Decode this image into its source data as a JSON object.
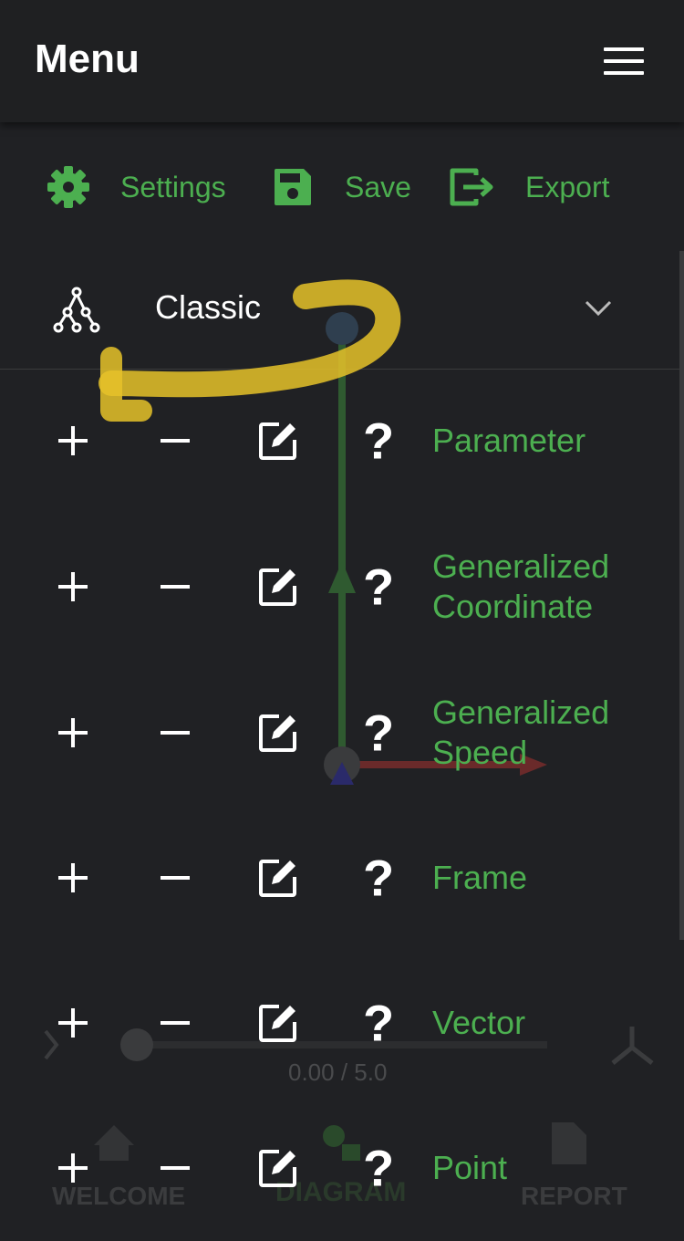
{
  "header": {
    "title": "Menu"
  },
  "toolbar": [
    {
      "id": "settings",
      "icon": "gear-icon",
      "label": "Settings"
    },
    {
      "id": "save",
      "icon": "floppy-disk-icon",
      "label": "Save"
    },
    {
      "id": "export",
      "icon": "export-icon",
      "label": "Export"
    }
  ],
  "mode_select": {
    "icon": "tree-icon",
    "selected": "Classic"
  },
  "items": [
    {
      "label": "Parameter"
    },
    {
      "label": "Generalized Coordinate"
    },
    {
      "label": "Generalized Speed"
    },
    {
      "label": "Frame"
    },
    {
      "label": "Vector"
    },
    {
      "label": "Point"
    }
  ],
  "background": {
    "time_readout": "0.00 / 5.0",
    "nav_tabs": [
      "WELCOME",
      "DIAGRAM",
      "REPORT"
    ]
  },
  "colors": {
    "accent": "#4caf50",
    "background": "#202124",
    "annotation": "#e6c229"
  }
}
